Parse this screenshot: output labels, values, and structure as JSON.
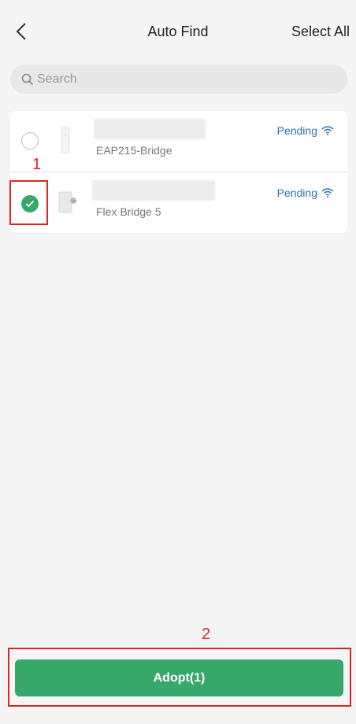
{
  "header": {
    "title": "Auto Find",
    "select_all_label": "Select All"
  },
  "search": {
    "placeholder": "Search",
    "value": ""
  },
  "devices": [
    {
      "model": "EAP215-Bridge",
      "status": "Pending",
      "selected": false,
      "icon": "ceiling-ap-device-icon"
    },
    {
      "model": "Flex Bridge 5",
      "status": "Pending",
      "selected": true,
      "icon": "bridge-device-icon"
    }
  ],
  "annotations": {
    "marker_1": "1",
    "marker_2": "2"
  },
  "footer": {
    "adopt_label": "Adopt(1)"
  },
  "colors": {
    "accent_green": "#38a86a",
    "status_blue": "#2f6fb3",
    "annotation_red": "#e02424"
  }
}
